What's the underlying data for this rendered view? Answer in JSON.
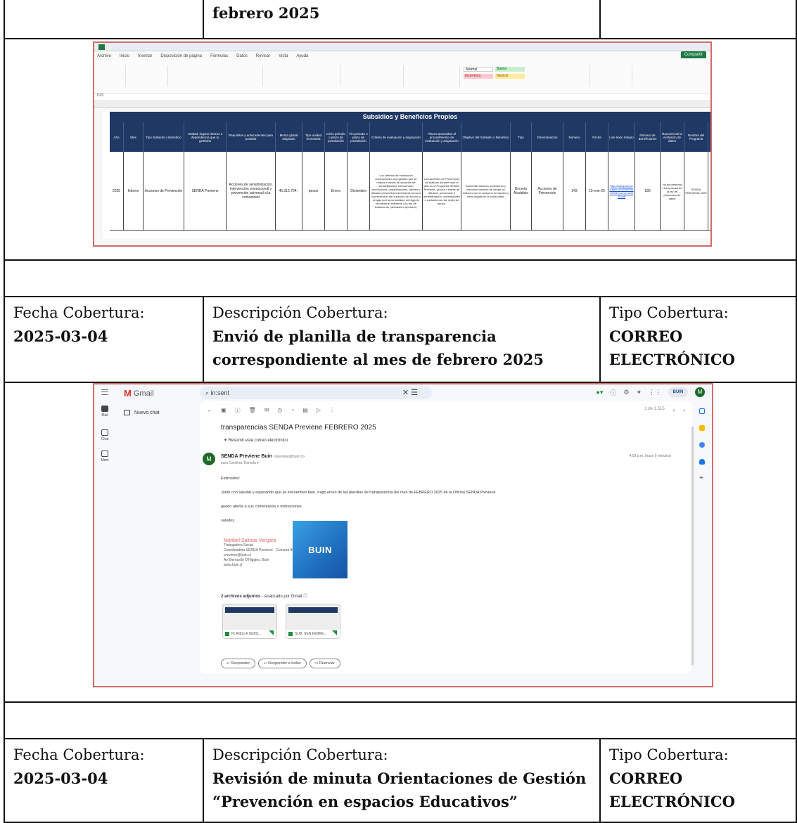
{
  "top_row": {
    "col2": "febrero 2025"
  },
  "screenshot1": {
    "menu": [
      "Archivo",
      "Inicio",
      "Insertar",
      "Disposición de página",
      "Fórmulas",
      "Datos",
      "Revisar",
      "Vista",
      "Ayuda"
    ],
    "share_label": "Compartir",
    "styles": [
      "Normal",
      "Bueno",
      "Incorrecto",
      "Neutral"
    ],
    "cell_ref": "D25",
    "banner": "Subsidios y Beneficios Propios",
    "headers": [
      "Año",
      "Mes",
      "Tipo Subsidio o Beneficio",
      "Unidad, órgano interno o dependencia que lo gestiona",
      "Requisitos y antecedentes para postular",
      "Monto global asignado",
      "Tipo unidad monetaria",
      "Inicio periodo o plazo de postulación",
      "Fin periodo o plazo de postulación",
      "Criterio de evaluación y asignación",
      "Plazos asociados al procedimiento de evaluación y asignación",
      "Objetivo del Subsidio o Beneficio",
      "Tipo",
      "Denominación",
      "Número",
      "Fecha",
      "Link texto íntegro",
      "Número de Beneficiarios",
      "Razones de la exclusión de datos",
      "Nombre del Programa"
    ],
    "row": [
      "2025",
      "febrero",
      "Acciones de Prevención",
      "SENDA Previene",
      "Acciones de sensibilización, intervención promocional y prevención universal a la comunidad",
      "45.312.704.-",
      "pesos",
      "Enero",
      "Diciembre",
      "Los criterios de evaluación corresponden a la gestión que se realiza a través de acciones de sensibilización, intervención promocional, capacitaciones, talleres y difusión preventiva universal de forma a la prevención del consumo de alcohol y drogas con la comunidad, entrega de información referente a la red de tratamiento (derivación oportuna).",
      "Las acciones de Prevención se realizan durante todo el año en el Programa SENDA Previene, ya sea a través de difusión, promoción y sensibilización, orientaciones o contacto con las redes de apoyo.",
      "Aumentar factores protectores y disminuir factores de riesgo en relación con el consumo de alcohol y otras drogas en la comunidad.",
      "Decreto Alcaldicio",
      "Acciones de Prevención",
      "143",
      "15-ene-25",
      "http://transparencia.buin.cl/2025/PREVIENE/convenio2025.pdf",
      "180",
      "No se presenta Link a causa de la ley de protección de datos",
      "SENDA PREVIENE 2025"
    ]
  },
  "info1": {
    "fecha_label": "Fecha Cobertura:",
    "fecha_value": "2025-03-04",
    "desc_label": "Descripción Cobertura:",
    "desc_value": "Envió de planilla de transparencia correspondiente al mes de febrero 2025",
    "tipo_label": "Tipo Cobertura:",
    "tipo_value": "CORREO ELECTRÓNICO"
  },
  "screenshot2": {
    "app_name": "Gmail",
    "search_value": "in:sent",
    "buin_badge": "BUIN",
    "user_initial": "M",
    "rail": [
      "Mail",
      "Chat",
      "Meet"
    ],
    "new_chat": "Nuevo chat",
    "pager": "1 de 1.515",
    "subject": "transparencias SENDA Previene FEBRERO 2025",
    "summary": "✦ Resumir este correo electrónico",
    "sender_name": "SENDA Previene Buin",
    "sender_addr": "<previene@buin.cl>",
    "to": "para Carolina, Daniela ▾",
    "date": "4:03 p.m. (hace 0 minutos)",
    "body_lines": [
      "Estimados:",
      "Junto con saludar y esperando que se encuentren bien, hago envío de las planillas de transparencia del mes de FEBRERO 2025 de la Oficina SENDA Previene",
      "quedo atenta a sus comentarios o indicaciones",
      "saludos"
    ],
    "sig_name": "Maribel Salinas Vergara",
    "sig_lines": [
      "Trabajadora Social",
      "Coordinadora SENDA Previene · Comuna Buin",
      "previene@buin.cl",
      "Av. Bernardo O'Higgins, Buin",
      "www.buin.cl"
    ],
    "sig_logo": "BUIN",
    "attachments_label": "2 archivos adjuntos",
    "attachments_scan": " · Analizado por Gmail ⓘ",
    "attachments": [
      "PLANILLA SUBS...",
      "SUB. SEN FEBRE..."
    ],
    "buttons": [
      "↩ Responder",
      "↩ Responder a todos",
      "↪ Reenviar"
    ]
  },
  "info2": {
    "fecha_label": "Fecha Cobertura:",
    "fecha_value": "2025-03-04",
    "desc_label": "Descripción Cobertura:",
    "desc_value": "Revisión de minuta Orientaciones de Gestión “Prevención en espacios Educativos”",
    "tipo_label": "Tipo Cobertura:",
    "tipo_value": "CORREO ELECTRÓNICO"
  }
}
